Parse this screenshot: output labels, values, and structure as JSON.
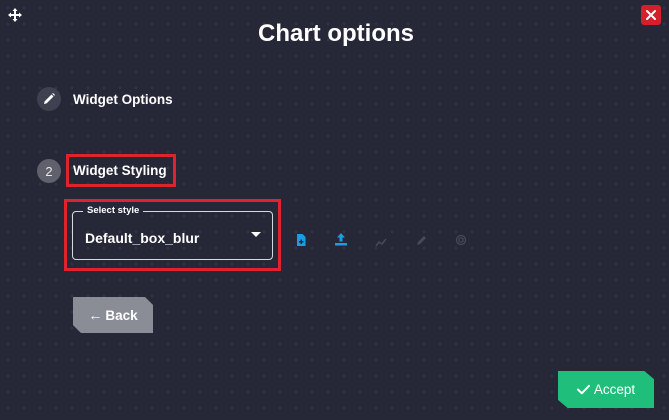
{
  "dialog": {
    "title": "Chart options"
  },
  "steps": [
    {
      "label": "Widget Options",
      "icon": "pencil-icon",
      "number": ""
    },
    {
      "label": "Widget Styling",
      "icon": "",
      "number": "2"
    }
  ],
  "style_select": {
    "legend": "Select style",
    "value": "Default_box_blur"
  },
  "toolbar_icons": [
    "new-file-icon",
    "upload-icon",
    "chart-icon",
    "edit-icon",
    "fingerprint-icon"
  ],
  "buttons": {
    "back_label": "Back",
    "accept_label": "Accept"
  },
  "colors": {
    "background": "#262838",
    "highlight": "#e0222f",
    "accent_icon": "#1b9ee0",
    "close": "#d61f2c",
    "accept": "#1fbe7a",
    "back": "#8a8c96"
  }
}
